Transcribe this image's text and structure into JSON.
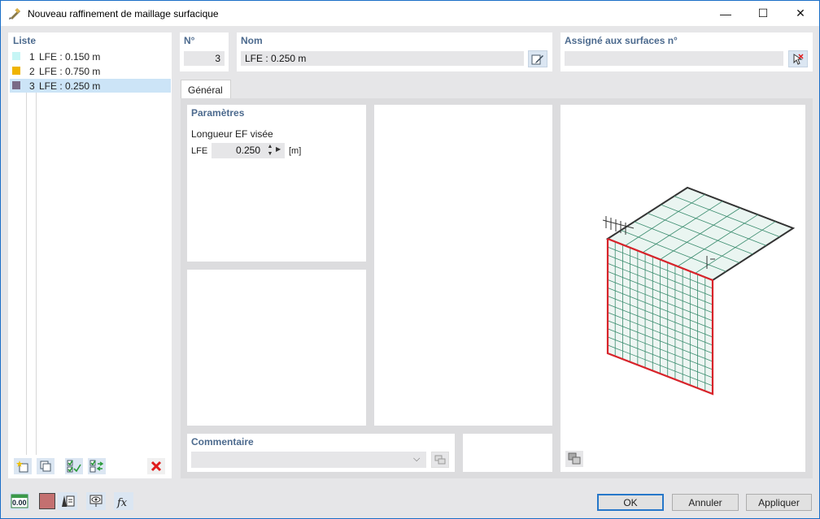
{
  "window": {
    "title": "Nouveau raffinement de maillage surfacique",
    "minimize_glyph": "—",
    "maximize_glyph": "☐",
    "close_glyph": "✕"
  },
  "list": {
    "label": "Liste",
    "items": [
      {
        "num": "1",
        "label": "LFE : 0.150 m",
        "color": "#c6f5f5"
      },
      {
        "num": "2",
        "label": "LFE : 0.750 m",
        "color": "#f0b400"
      },
      {
        "num": "3",
        "label": "LFE : 0.250 m",
        "color": "#7a6a86"
      }
    ],
    "selected_index": 2
  },
  "header": {
    "no_label": "N°",
    "no_value": "3",
    "name_label": "Nom",
    "name_value": "LFE : 0.250 m",
    "assigned_label": "Assigné aux surfaces n°",
    "assigned_value": ""
  },
  "tabs": [
    {
      "label": "Général",
      "active": true
    }
  ],
  "params": {
    "section_label": "Paramètres",
    "field_label": "Longueur EF visée",
    "symbol": "LFE",
    "value": "0.250",
    "unit": "[m]"
  },
  "comment": {
    "label": "Commentaire",
    "value": ""
  },
  "footer": {
    "ok_label": "OK",
    "cancel_label": "Annuler",
    "apply_label": "Appliquer",
    "units_icon_text": "0.00"
  },
  "colors": {
    "accent_blue": "#1a6ec7",
    "label_blue": "#4c6a8e",
    "selection": "#cce4f7",
    "mesh_green": "#3a8c6e",
    "edge_red": "#d8232a",
    "color_swatch": "#c47070",
    "delete_red": "#e01b1b"
  }
}
